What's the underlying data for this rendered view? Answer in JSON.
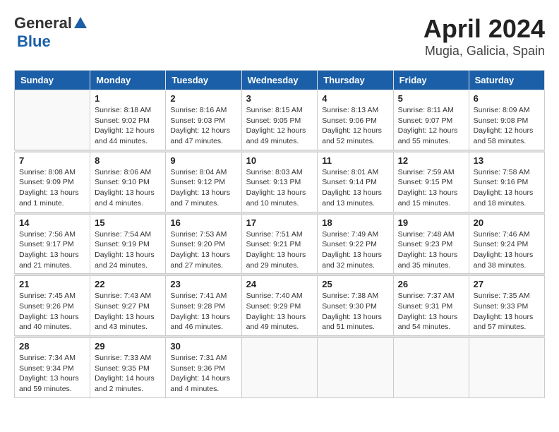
{
  "header": {
    "logo_general": "General",
    "logo_blue": "Blue",
    "month": "April 2024",
    "location": "Mugia, Galicia, Spain"
  },
  "weekdays": [
    "Sunday",
    "Monday",
    "Tuesday",
    "Wednesday",
    "Thursday",
    "Friday",
    "Saturday"
  ],
  "weeks": [
    [
      {
        "day": "",
        "info": ""
      },
      {
        "day": "1",
        "info": "Sunrise: 8:18 AM\nSunset: 9:02 PM\nDaylight: 12 hours\nand 44 minutes."
      },
      {
        "day": "2",
        "info": "Sunrise: 8:16 AM\nSunset: 9:03 PM\nDaylight: 12 hours\nand 47 minutes."
      },
      {
        "day": "3",
        "info": "Sunrise: 8:15 AM\nSunset: 9:05 PM\nDaylight: 12 hours\nand 49 minutes."
      },
      {
        "day": "4",
        "info": "Sunrise: 8:13 AM\nSunset: 9:06 PM\nDaylight: 12 hours\nand 52 minutes."
      },
      {
        "day": "5",
        "info": "Sunrise: 8:11 AM\nSunset: 9:07 PM\nDaylight: 12 hours\nand 55 minutes."
      },
      {
        "day": "6",
        "info": "Sunrise: 8:09 AM\nSunset: 9:08 PM\nDaylight: 12 hours\nand 58 minutes."
      }
    ],
    [
      {
        "day": "7",
        "info": "Sunrise: 8:08 AM\nSunset: 9:09 PM\nDaylight: 13 hours\nand 1 minute."
      },
      {
        "day": "8",
        "info": "Sunrise: 8:06 AM\nSunset: 9:10 PM\nDaylight: 13 hours\nand 4 minutes."
      },
      {
        "day": "9",
        "info": "Sunrise: 8:04 AM\nSunset: 9:12 PM\nDaylight: 13 hours\nand 7 minutes."
      },
      {
        "day": "10",
        "info": "Sunrise: 8:03 AM\nSunset: 9:13 PM\nDaylight: 13 hours\nand 10 minutes."
      },
      {
        "day": "11",
        "info": "Sunrise: 8:01 AM\nSunset: 9:14 PM\nDaylight: 13 hours\nand 13 minutes."
      },
      {
        "day": "12",
        "info": "Sunrise: 7:59 AM\nSunset: 9:15 PM\nDaylight: 13 hours\nand 15 minutes."
      },
      {
        "day": "13",
        "info": "Sunrise: 7:58 AM\nSunset: 9:16 PM\nDaylight: 13 hours\nand 18 minutes."
      }
    ],
    [
      {
        "day": "14",
        "info": "Sunrise: 7:56 AM\nSunset: 9:17 PM\nDaylight: 13 hours\nand 21 minutes."
      },
      {
        "day": "15",
        "info": "Sunrise: 7:54 AM\nSunset: 9:19 PM\nDaylight: 13 hours\nand 24 minutes."
      },
      {
        "day": "16",
        "info": "Sunrise: 7:53 AM\nSunset: 9:20 PM\nDaylight: 13 hours\nand 27 minutes."
      },
      {
        "day": "17",
        "info": "Sunrise: 7:51 AM\nSunset: 9:21 PM\nDaylight: 13 hours\nand 29 minutes."
      },
      {
        "day": "18",
        "info": "Sunrise: 7:49 AM\nSunset: 9:22 PM\nDaylight: 13 hours\nand 32 minutes."
      },
      {
        "day": "19",
        "info": "Sunrise: 7:48 AM\nSunset: 9:23 PM\nDaylight: 13 hours\nand 35 minutes."
      },
      {
        "day": "20",
        "info": "Sunrise: 7:46 AM\nSunset: 9:24 PM\nDaylight: 13 hours\nand 38 minutes."
      }
    ],
    [
      {
        "day": "21",
        "info": "Sunrise: 7:45 AM\nSunset: 9:26 PM\nDaylight: 13 hours\nand 40 minutes."
      },
      {
        "day": "22",
        "info": "Sunrise: 7:43 AM\nSunset: 9:27 PM\nDaylight: 13 hours\nand 43 minutes."
      },
      {
        "day": "23",
        "info": "Sunrise: 7:41 AM\nSunset: 9:28 PM\nDaylight: 13 hours\nand 46 minutes."
      },
      {
        "day": "24",
        "info": "Sunrise: 7:40 AM\nSunset: 9:29 PM\nDaylight: 13 hours\nand 49 minutes."
      },
      {
        "day": "25",
        "info": "Sunrise: 7:38 AM\nSunset: 9:30 PM\nDaylight: 13 hours\nand 51 minutes."
      },
      {
        "day": "26",
        "info": "Sunrise: 7:37 AM\nSunset: 9:31 PM\nDaylight: 13 hours\nand 54 minutes."
      },
      {
        "day": "27",
        "info": "Sunrise: 7:35 AM\nSunset: 9:33 PM\nDaylight: 13 hours\nand 57 minutes."
      }
    ],
    [
      {
        "day": "28",
        "info": "Sunrise: 7:34 AM\nSunset: 9:34 PM\nDaylight: 13 hours\nand 59 minutes."
      },
      {
        "day": "29",
        "info": "Sunrise: 7:33 AM\nSunset: 9:35 PM\nDaylight: 14 hours\nand 2 minutes."
      },
      {
        "day": "30",
        "info": "Sunrise: 7:31 AM\nSunset: 9:36 PM\nDaylight: 14 hours\nand 4 minutes."
      },
      {
        "day": "",
        "info": ""
      },
      {
        "day": "",
        "info": ""
      },
      {
        "day": "",
        "info": ""
      },
      {
        "day": "",
        "info": ""
      }
    ]
  ]
}
